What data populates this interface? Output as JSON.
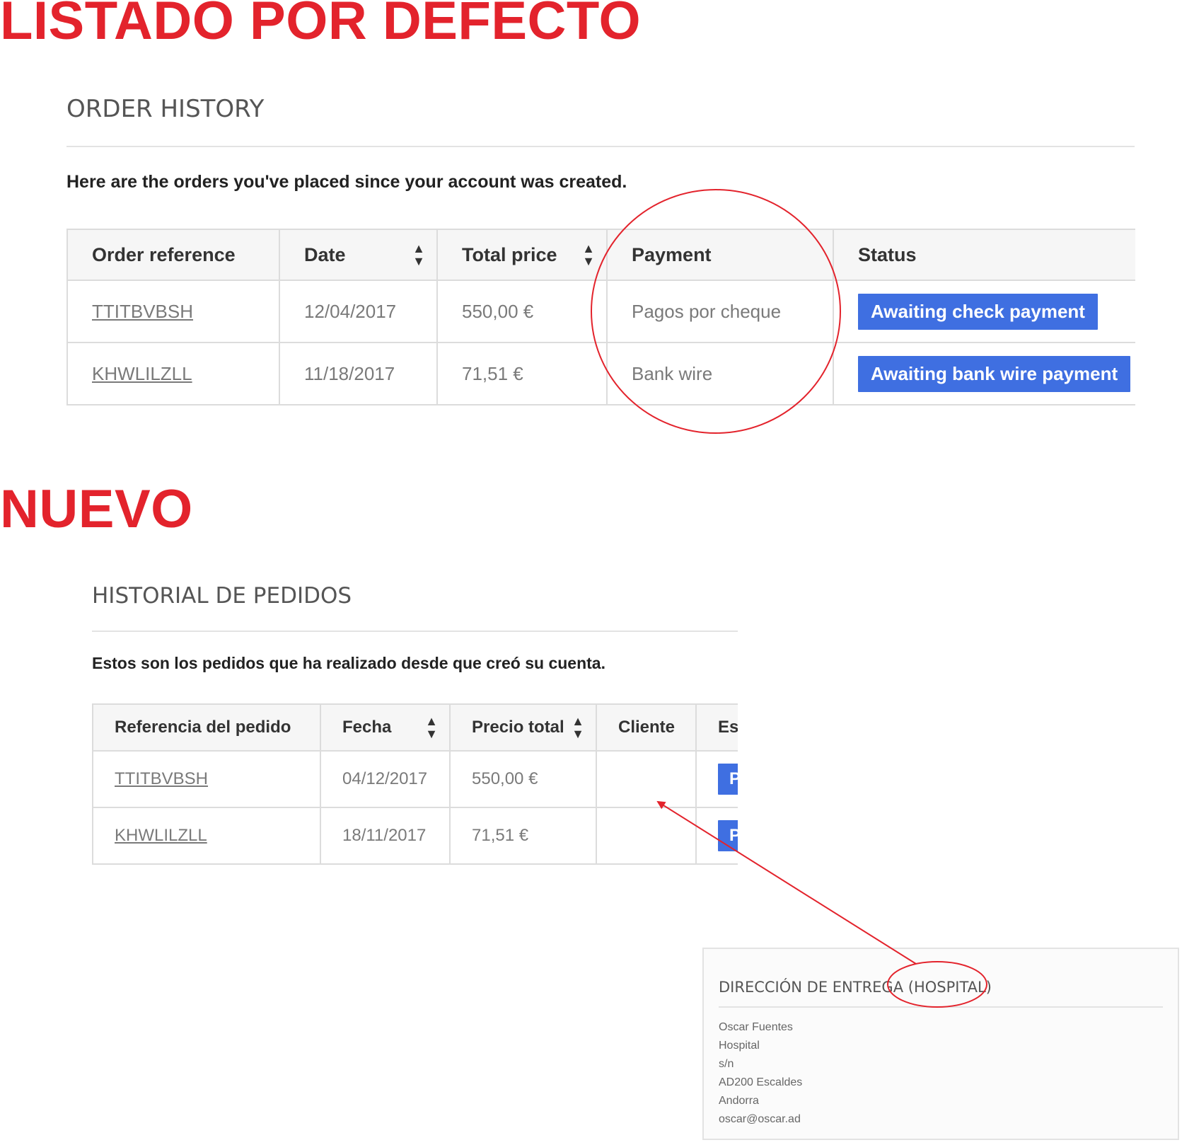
{
  "default_section": {
    "title": "LISTADO POR DEFECTO",
    "heading": "ORDER HISTORY",
    "intro": "Here are the orders you've placed since your account was created.",
    "columns": [
      "Order reference",
      "Date",
      "Total price",
      "Payment",
      "Status"
    ],
    "rows": [
      {
        "reference": "TTITBVBSH",
        "date": "12/04/2017",
        "total": "550,00 €",
        "payment": "Pagos por cheque",
        "status": "Awaiting check payment"
      },
      {
        "reference": "KHWLILZLL",
        "date": "11/18/2017",
        "total": "71,51 €",
        "payment": "Bank wire",
        "status": "Awaiting bank wire payment"
      }
    ]
  },
  "new_section": {
    "title": "NUEVO",
    "heading": "HISTORIAL DE PEDIDOS",
    "intro": "Estos son los pedidos que ha realizado desde que creó su cuenta.",
    "columns": [
      "Referencia del pedido",
      "Fecha",
      "Precio total",
      "Cliente",
      "Es"
    ],
    "rows": [
      {
        "reference": "TTITBVBSH",
        "date": "04/12/2017",
        "total": "550,00 €",
        "client": "",
        "status": "P"
      },
      {
        "reference": "KHWLILZLL",
        "date": "18/11/2017",
        "total": "71,51 €",
        "client": "",
        "status": "P"
      }
    ]
  },
  "address_box": {
    "heading": "DIRECCIÓN DE ENTREGA (HOSPITAL)",
    "lines": [
      "Oscar Fuentes",
      "Hospital",
      "s/n",
      "AD200 Escaldes",
      "Andorra",
      "oscar@oscar.ad"
    ]
  },
  "icons": {
    "sort": "sort-icon"
  },
  "colors": {
    "accent_red": "#e3232c",
    "badge_blue": "#3f6fe1"
  }
}
